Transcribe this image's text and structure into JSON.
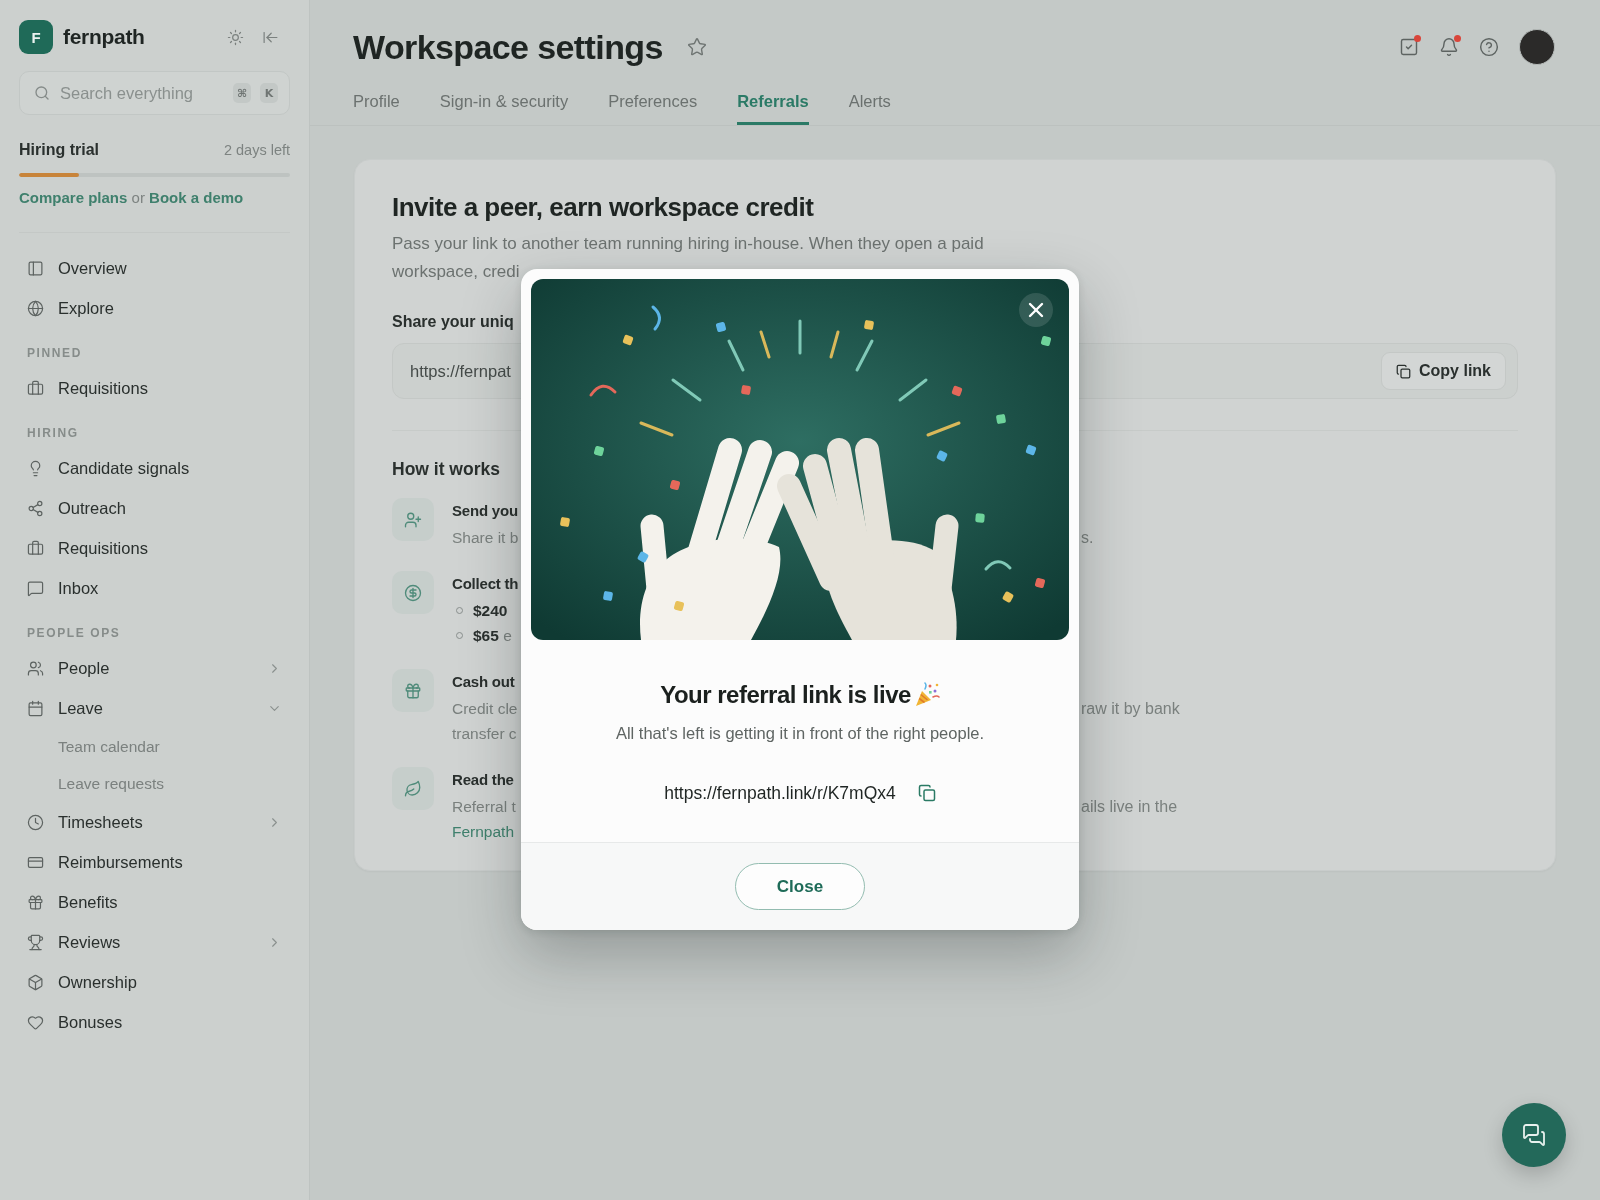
{
  "sidebar": {
    "brand": {
      "initial": "F",
      "name": "fernpath"
    },
    "search": {
      "placeholder": "Search everything",
      "keys": [
        "⌘",
        "K"
      ]
    },
    "trial": {
      "title": "Hiring trial",
      "remaining": "2 days left",
      "level": 0.22,
      "upgrade": [
        {
          "kind": "link",
          "text": "Compare plans"
        },
        {
          "kind": "text",
          "text": "or"
        },
        {
          "kind": "link",
          "text": "Book a demo"
        }
      ]
    },
    "sections": [
      {
        "items": [
          {
            "label": "Overview"
          },
          {
            "label": "Explore"
          }
        ]
      },
      {
        "title": "PINNED",
        "items": [
          {
            "label": "Requisitions"
          }
        ]
      },
      {
        "title": "HIRING",
        "items": [
          {
            "label": "Candidate signals"
          },
          {
            "label": "Outreach"
          },
          {
            "label": "Requisitions"
          },
          {
            "label": "Inbox"
          }
        ]
      },
      {
        "title": "PEOPLE OPS",
        "items": [
          {
            "label": "People",
            "expanded": false
          },
          {
            "label": "Leave",
            "expanded": true,
            "children": [
              {
                "label": "Team calendar"
              },
              {
                "label": "Leave requests"
              }
            ]
          },
          {
            "label": "Timesheets",
            "expanded": false
          },
          {
            "label": "Reimbursements"
          },
          {
            "label": "Benefits"
          },
          {
            "label": "Reviews",
            "expanded": false
          },
          {
            "label": "Ownership"
          },
          {
            "label": "Bonuses"
          }
        ]
      }
    ]
  },
  "header": {
    "title": "Workspace settings",
    "actions": [
      {
        "badge": true
      },
      {
        "badge": true
      },
      {
        "badge": false
      }
    ]
  },
  "tabs": [
    {
      "label": "Profile",
      "selected": false
    },
    {
      "label": "Sign-in & security",
      "selected": false
    },
    {
      "label": "Preferences",
      "selected": false
    },
    {
      "label": "Referrals",
      "selected": true
    },
    {
      "label": "Alerts",
      "selected": false
    }
  ],
  "referral_card": {
    "title": "Invite a peer, earn workspace credit",
    "description": "Pass your link to another team running hiring in-house. When they open a paid workspace, credi",
    "link_label": "Share your uniq",
    "link_value": "https://fernpat",
    "copy_button": "Copy link",
    "how_title": "How it works",
    "steps": [
      {
        "title": "Send you",
        "lines": [
          {
            "kind": "text",
            "text": "Share it b"
          }
        ],
        "right_text": "s."
      },
      {
        "title": "Collect th",
        "bullets": [
          {
            "amount": "$240"
          },
          {
            "amount": "$65",
            "text": "e"
          }
        ]
      },
      {
        "title": "Cash out",
        "lines": [
          {
            "kind": "text",
            "text": "Credit cle"
          },
          {
            "kind": "text",
            "text": "transfer c"
          }
        ],
        "right_text": "raw it by bank"
      },
      {
        "title": "Read the",
        "lines": [
          {
            "kind": "text",
            "text": "Referral t"
          },
          {
            "kind": "link",
            "text": "Fernpath"
          }
        ],
        "right_text": "ails live in the"
      }
    ]
  },
  "modal": {
    "title": "Your referral link is live",
    "subtitle": "All that's left is getting it in front of the right people.",
    "link": "https://fernpath.link/r/K7mQx4",
    "close_button": "Close"
  }
}
